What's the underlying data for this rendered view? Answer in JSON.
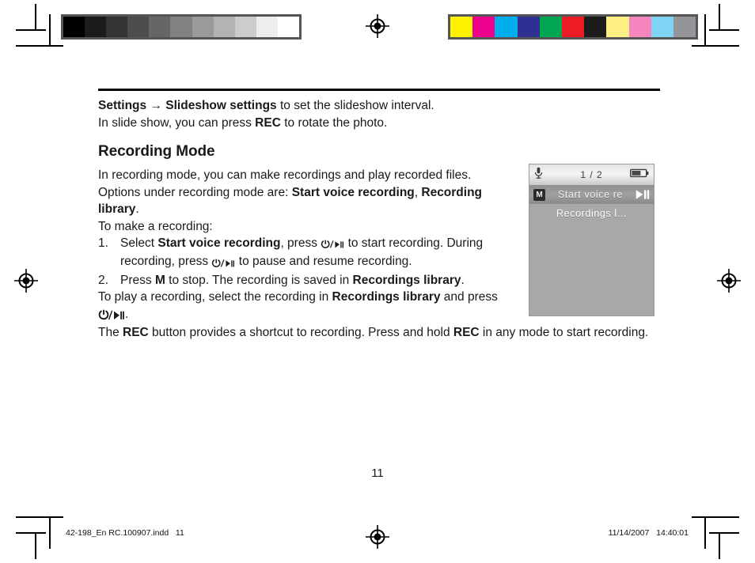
{
  "document": {
    "page_number": "11",
    "footer_left": "42-198_En RC.100907.indd   11",
    "footer_right": "11/14/2007   14:40:01"
  },
  "intro": {
    "line1_bold_a": "Settings",
    "line1_arrow": " → ",
    "line1_bold_b": "Slideshow settings",
    "line1_rest": " to set the slideshow interval.",
    "line2_a": "In slide show, you can press ",
    "line2_bold": "REC",
    "line2_b": " to rotate the photo."
  },
  "section": {
    "title": "Recording Mode",
    "p1_a": "In recording mode, you can make recordings and play recorded files. Options under recording mode are: ",
    "p1_bold_a": "Start voice recording",
    "p1_mid": ", ",
    "p1_bold_b": "Recording library",
    "p1_end": ".",
    "p2": "To make a recording:",
    "steps": [
      {
        "num": "1.",
        "a": "Select ",
        "bold_a": "Start voice recording",
        "b": ", press ",
        "icon": "power-play-pause-icon",
        "c": " to start recording. During recording, press ",
        "icon2": "power-play-pause-icon",
        "d": " to pause and resume recording."
      },
      {
        "num": "2.",
        "a": "Press ",
        "bold_a": "M",
        "b": " to stop. The recording is saved in ",
        "bold_b": "Recordings library",
        "c": "."
      }
    ],
    "p3_a": "To play a recording, select the recording in ",
    "p3_bold_a": "Recordings library",
    "p3_b": " and press ",
    "p3_icon": "power-play-pause-icon",
    "p3_c": ".",
    "p4_a": "The ",
    "p4_bold_a": "REC",
    "p4_b": " button provides a shortcut to recording. Press and hold ",
    "p4_bold_b": "REC",
    "p4_c": " in any mode to start recording."
  },
  "device_screen": {
    "status": {
      "mic_icon": "microphone-icon",
      "page_count": "1 / 2",
      "battery_icon": "battery-icon"
    },
    "rows": [
      {
        "badge": "M",
        "label": "Start  voice  re",
        "end_icon": "play-pause-icon",
        "selected": true
      },
      {
        "label": "Recordings  l...",
        "selected": false
      }
    ]
  },
  "calibration": {
    "grayscale": [
      "#000000",
      "#1b1b1b",
      "#333333",
      "#4d4d4d",
      "#666666",
      "#828282",
      "#9a9a9a",
      "#b3b3b3",
      "#cccccc",
      "#ededed",
      "#ffffff"
    ],
    "colors": [
      "#fff200",
      "#ec008c",
      "#00aeef",
      "#2e3192",
      "#00a651",
      "#ed1c24",
      "#1c1c1c",
      "#fdef84",
      "#f586be",
      "#7fd4f5",
      "#939598"
    ]
  },
  "marks": {
    "registration_icon": "registration-target-icon",
    "crop_mark": "crop-mark"
  }
}
